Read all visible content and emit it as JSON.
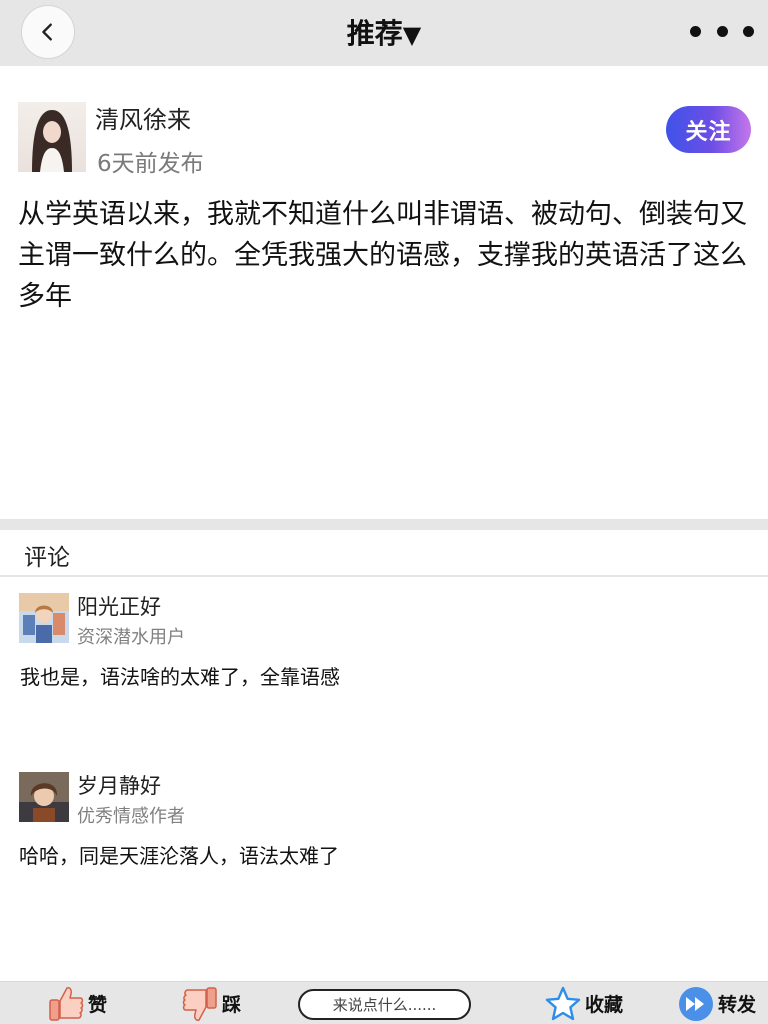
{
  "header": {
    "title": "推荐",
    "title_caret": "▼"
  },
  "post": {
    "author": "清风徐来",
    "time": "6天前发布",
    "follow_label": "关注",
    "text": "从学英语以来，我就不知道什么叫非谓语、被动句、倒装句又主谓一致什么的。全凭我强大的语感，支撑我的英语活了这么多年"
  },
  "comments_section": {
    "title": "评论",
    "items": [
      {
        "name": "阳光正好",
        "badge": "资深潜水用户",
        "text": "我也是，语法啥的太难了，全靠语感"
      },
      {
        "name": "岁月静好",
        "badge": "优秀情感作者",
        "text": "哈哈，同是天涯沦落人，语法太难了"
      }
    ]
  },
  "bottom_bar": {
    "like_label": "赞",
    "dislike_label": "踩",
    "comment_placeholder": "来说点什么......",
    "favorite_label": "收藏",
    "share_label": "转发"
  },
  "colors": {
    "bar_bg": "#e6e6e6",
    "follow_gradient_start": "#3f53e8",
    "follow_gradient_end": "#c477ea",
    "star_blue": "#2e8de8"
  }
}
